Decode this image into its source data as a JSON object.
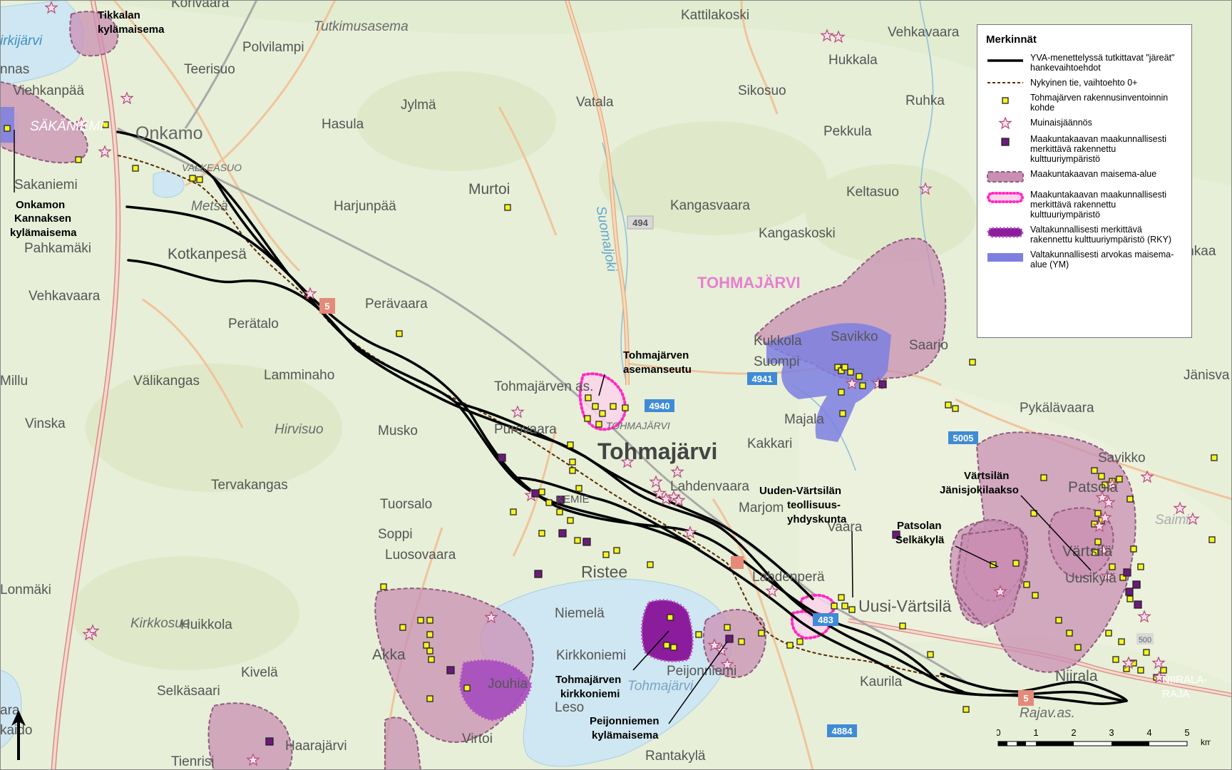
{
  "legend": {
    "title": "Merkinnät",
    "items": [
      {
        "label": "YVA-menettelyssä tutkittavat \"järeät\" hankevaihtoehdot"
      },
      {
        "label": "Nykyinen tie, vaihtoehto 0+"
      },
      {
        "label": "Tohmajärven rakennusinventoinnin kohde"
      },
      {
        "label": "Muinaisjäännös"
      },
      {
        "label": "Maakuntakaavan maakunnallisesti merkittävä rakennettu kulttuuriympäristö"
      },
      {
        "label": "Maakuntakaavan maisema-alue"
      },
      {
        "label": "Maakuntakaavan maakunnallisesti merkittävä rakennettu kulttuuriympäristö"
      },
      {
        "label": "Valtakunnallisesti merkittävä rakennettu kulttuuriympäristö (RKY)"
      },
      {
        "label": "Valtakunnallisesti arvokas maisema-alue (YM)"
      }
    ]
  },
  "annotations": {
    "tikkala": [
      "Tikkalan",
      "kylämaisema"
    ],
    "onkamo": [
      "Onkamon",
      "Kannaksen",
      "kylämaisema"
    ],
    "asema": [
      "Tohmajärven",
      "asemanseutu"
    ],
    "uusi_vartsila": [
      "Uuden-Värtsilän",
      "teollisuus-",
      "yhdyskunta"
    ],
    "patsola": [
      "Patsolan",
      "Selkäkylä"
    ],
    "vartsila_jk": [
      "Värtsilän",
      "Jänisjokilaakso"
    ],
    "kirkkoniemi": [
      "Tohmajärven",
      "kirkkoniemi"
    ],
    "peijonniemi": [
      "Peijonniemen",
      "kylämaisema"
    ]
  },
  "places": {
    "korivaara": "Korivaara",
    "kattilakoski": "Kattilakoski",
    "vehkavaara_n": "Vehkavaara",
    "tutkimusasema": "Tutkimusasema",
    "polvilampi": "Polvilampi",
    "teerisuo": "Teerisuo",
    "hukkala": "Hukkala",
    "kirkjarvi": "irkijärvi",
    "nnas": "nnas",
    "viehkanpaa": "Viehkanpää",
    "sakaniemi_i": "SÄKÄNIEMI",
    "onkamo": "Onkamo",
    "jylma": "Jylmä",
    "vatala": "Vatala",
    "sikosuo": "Sikosuo",
    "ruhka": "Ruhka",
    "hasula": "Hasula",
    "pekkula": "Pekkula",
    "valkeasuo": "VALKEASUO",
    "sakaniemi": "Sakaniemi",
    "murtoi": "Murtoi",
    "keltasuo": "Keltasuo",
    "harjunpaa": "Harjunpää",
    "metsa": "Metsä",
    "kangasvaara": "Kangasvaara",
    "suomaljoki": "Suomaljoki",
    "pahkamaki": "Pahkamäki",
    "kotkanpesa": "Kotkanpesä",
    "kangaskoski": "Kangaskoski",
    "kankaa": "Kankaa",
    "vehkavaara_w": "Vehkavaara",
    "peravaara": "Perävaara",
    "tohmajarvi_muni": "TOHMAJÄRVI",
    "peratalo": "Perätalo",
    "lamminaho": "Lamminaho",
    "kukkola": "Kukkola",
    "suompi": "Suompi",
    "saario": "Saario",
    "savikko_n": "Savikko",
    "milu": "Millu",
    "valikangas": "Välikangas",
    "tohmajarven_as": "Tohmajärven as.",
    "janisvaara": "Jänisva",
    "vinska": "Vinska",
    "hirvisuo": "Hirvisuo",
    "musko": "Musko",
    "purovaara": "Purovaara",
    "tohmajarvi_s": "TOHMAJÄRVI",
    "majala": "Majala",
    "pykalavaara": "Pykälävaara",
    "kakkari": "Kakkari",
    "tohmajarvi_town": "Tohmajärvi",
    "tervakangas": "Tervakangas",
    "lahdenvaara": "Lahdenvaara",
    "kemie": "KEMIE",
    "marjomaki": "Marjom",
    "savikko_e": "Savikko",
    "patsola": "Patsola",
    "tuorsalo": "Tuorsalo",
    "soppi": "Soppi",
    "luosovaara": "Luosovaara",
    "vartsila": "Värtsilä",
    "vaaranlahti": "Vaara",
    "saimi": "Saimi",
    "uusikyla": "Uusikylä",
    "ristee": "Ristee",
    "lahdenpera": "Lahdenperä",
    "uusi_vartsila": "Uusi-Värtsilä",
    "niemela": "Niemelä",
    "lonnmaki": "Lonmäki",
    "huikkola": "Huikkola",
    "kirkkosuo": "Kirkkosuo",
    "akka": "Akka",
    "kirkkoniemi": "Kirkkoniemi",
    "peijonniemi": "Peijonniemi",
    "kivela": "Kivelä",
    "niirala": "Niirala",
    "selkasaari": "Selkäsaari",
    "jouhia": "Jouhia",
    "tohmajarvi_lake": "Tohmajärvi",
    "kaurila": "Kaurila",
    "niirala_raja": [
      "NIIRALA-",
      "RAJA"
    ],
    "rajav": "Rajav.as.",
    "leso": "Leso",
    "haarajarvi": "Haarajärvi",
    "virtoi": "Virtoi",
    "rantakyla": "Rantakylä",
    "ara": "ara",
    "kaido": "kaido",
    "tienrisi": "Tienrisi"
  },
  "roads": {
    "r494": "494",
    "r4941": "4941",
    "r4940": "4940",
    "r5005": "5005",
    "r4884": "4884",
    "r483": "483",
    "r5a": "5",
    "r5b": "5",
    "r500": "500"
  },
  "scale": {
    "ticks": [
      "0",
      "1",
      "2",
      "3",
      "4",
      "5"
    ],
    "unit": "km"
  },
  "colors": {
    "yva_line": "#000000",
    "current_road": "#5a2a00",
    "inventory_fill": "#f5f51e",
    "ancient_star": "#e05a8a",
    "maakunta_site": "#6b1a7a",
    "landscape_fill": "#c98fb3",
    "landscape_border": "#8e5b7d",
    "maakunta_env_fill": "#fbd3ea",
    "maakunta_env_border": "#ff2bc2",
    "rky_fill": "#8b1c9b",
    "ym_fill": "#7d7fe0"
  }
}
